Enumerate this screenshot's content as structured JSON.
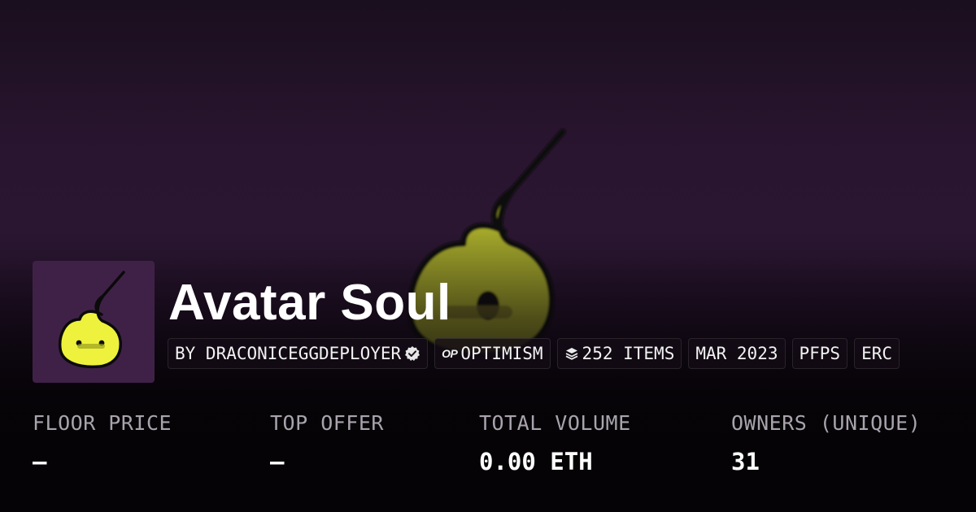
{
  "collection": {
    "name": "Avatar Soul",
    "creator_label": "BY DRACONICEGGDEPLOYER",
    "chain_label": "OPTIMISM",
    "chain_badge": "OP",
    "items_label": "252 ITEMS",
    "date_label": "MAR 2023",
    "category_label": "PFPS",
    "standard_label": "ERC"
  },
  "stats": [
    {
      "label": "FLOOR PRICE",
      "value": "–"
    },
    {
      "label": "TOP OFFER",
      "value": "–"
    },
    {
      "label": "TOTAL VOLUME",
      "value": "0.00 ETH"
    },
    {
      "label": "OWNERS (UNIQUE)",
      "value": "31"
    }
  ],
  "colors": {
    "background_purple": "#2b1632",
    "thumbnail_bg": "#3f2147",
    "creature_green": "#a4a82a",
    "creature_yellow": "#eef23c",
    "label_gray": "#a8a3ac"
  },
  "icons": {
    "verified": "verified-badge-icon",
    "layers": "layers-icon"
  }
}
